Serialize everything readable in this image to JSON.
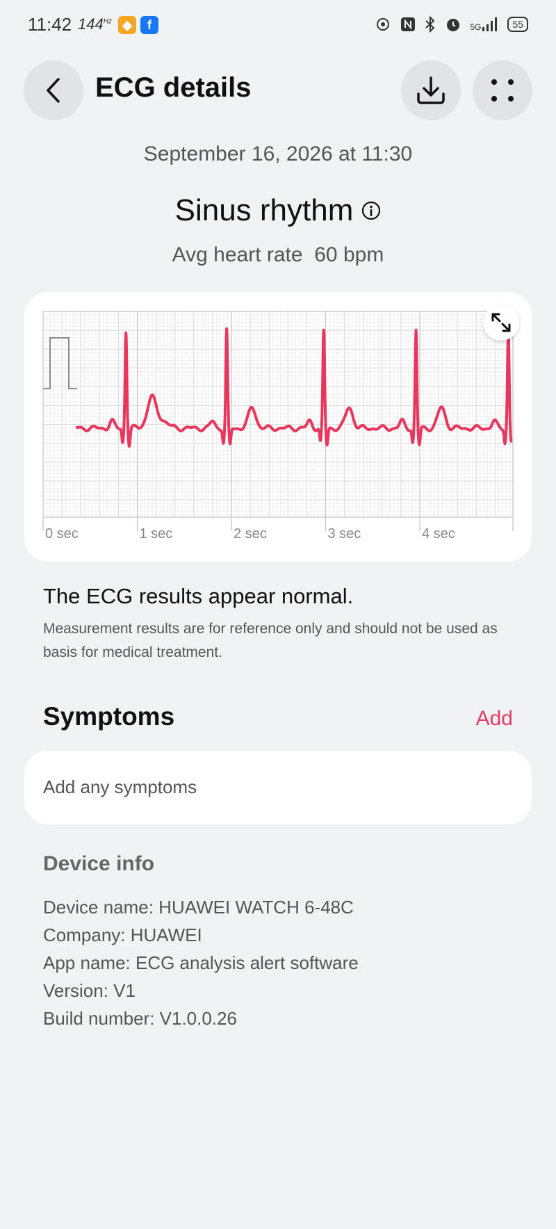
{
  "status_bar": {
    "time": "11:42",
    "refresh_rate": "144",
    "refresh_unit": "Hz",
    "network": "5G",
    "battery": "55"
  },
  "header": {
    "title": "ECG details"
  },
  "record": {
    "date": "September 16, 2026 at 11:30",
    "rhythm": "Sinus rhythm",
    "avg_label": "Avg heart rate",
    "avg_value": "60 bpm"
  },
  "chart_data": {
    "type": "line",
    "x_unit": "sec",
    "xlim": [
      0,
      5
    ],
    "x_ticks": [
      "0 sec",
      "1 sec",
      "2 sec",
      "3 sec",
      "4 sec"
    ],
    "grid": true,
    "color": "#e8365d",
    "r_peaks_sec": [
      0.88,
      1.95,
      2.98,
      3.96,
      4.94
    ],
    "heart_rate_bpm": 60
  },
  "result": {
    "title": "The ECG results appear normal.",
    "disclaimer": "Measurement results are for reference only and should not be used as basis for medical treatment."
  },
  "symptoms": {
    "title": "Symptoms",
    "add_label": "Add",
    "placeholder": "Add any symptoms"
  },
  "device": {
    "title": "Device info",
    "lines": [
      "Device name: HUAWEI WATCH 6-48C",
      "Company: HUAWEI",
      "App name: ECG analysis alert software",
      "Version: V1",
      "Build number: V1.0.0.26"
    ]
  },
  "colors": {
    "accent": "#e23d64",
    "background": "#f1f2f4"
  },
  "icons": [
    "back-icon",
    "download-icon",
    "more-icon",
    "info-icon",
    "expand-icon"
  ]
}
